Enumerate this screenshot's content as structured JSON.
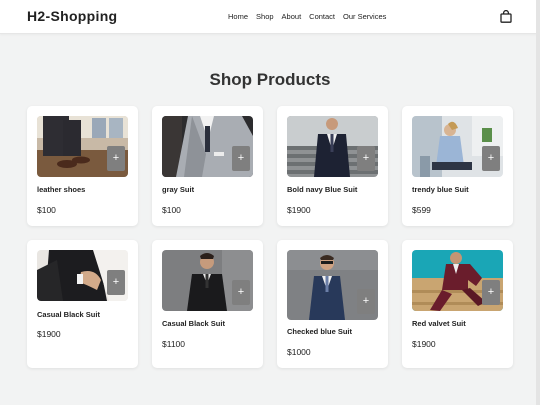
{
  "header": {
    "brand": "H2-Shopping",
    "nav": [
      "Home",
      "Shop",
      "About",
      "Contact",
      "Our Services"
    ],
    "cart_icon": "shopping-bag-icon"
  },
  "main": {
    "title": "Shop Products",
    "add_label": "+",
    "products": [
      {
        "name": "leather shoes",
        "price": "$100"
      },
      {
        "name": "gray Suit",
        "price": "$100"
      },
      {
        "name": "Bold navy Blue Suit",
        "price": "$1900"
      },
      {
        "name": "trendy blue Suit",
        "price": "$599"
      },
      {
        "name": "Casual Black Suit",
        "price": "$1900"
      },
      {
        "name": "Casual Black Suit",
        "price": "$1100"
      },
      {
        "name": "Checked blue Suit",
        "price": "$1000"
      },
      {
        "name": "Red valvet Suit",
        "price": "$1900"
      }
    ]
  },
  "colors": {
    "background": "#f2f3f3",
    "card": "#ffffff",
    "add_button": "#7f7f7f",
    "text": "#222222"
  }
}
